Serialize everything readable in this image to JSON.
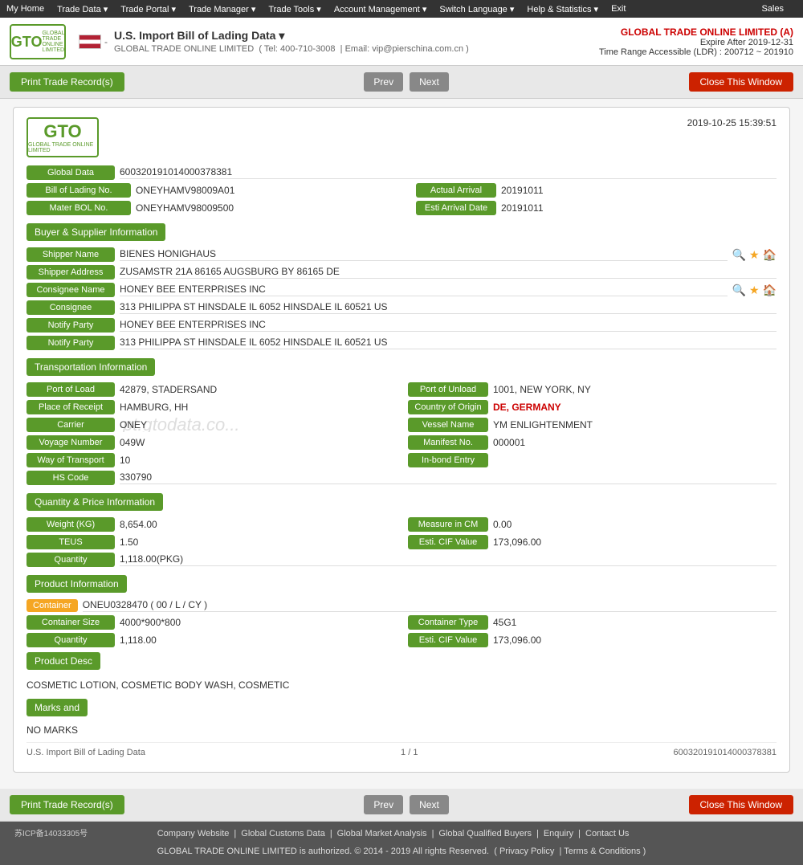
{
  "topnav": {
    "items": [
      "My Home",
      "Trade Data",
      "Trade Portal",
      "Trade Manager",
      "Trade Tools",
      "Account Management",
      "Switch Language",
      "Help & Statistics",
      "Exit"
    ],
    "sales": "Sales"
  },
  "header": {
    "title": "U.S. Import Bill of Lading Data  ▾",
    "company": "GLOBAL TRADE ONLINE LIMITED",
    "phone": "Tel: 400-710-3008",
    "email": "Email: vip@pierschina.com.cn",
    "account": "GLOBAL TRADE ONLINE LIMITED (A)",
    "expire": "Expire After 2019-12-31",
    "time_range": "Time Range Accessible (LDR) : 200712 ~ 201910"
  },
  "toolbar": {
    "print_label": "Print Trade Record(s)",
    "prev_label": "Prev",
    "next_label": "Next",
    "close_label": "Close This Window"
  },
  "document": {
    "timestamp": "2019-10-25 15:39:51",
    "global_data_label": "Global Data",
    "global_data_value": "600320191014000378381",
    "bol_label": "Bill of Lading No.",
    "bol_value": "ONEYHAMV98009A01",
    "actual_arrival_label": "Actual Arrival",
    "actual_arrival_value": "20191011",
    "mater_bol_label": "Mater BOL No.",
    "mater_bol_value": "ONEYHAMV98009500",
    "esti_arrival_label": "Esti Arrival Date",
    "esti_arrival_value": "20191011"
  },
  "buyer_supplier": {
    "section_title": "Buyer & Supplier Information",
    "shipper_name_label": "Shipper Name",
    "shipper_name_value": "BIENES HONIGHAUS",
    "shipper_address_label": "Shipper Address",
    "shipper_address_value": "ZUSAMSTR 21A 86165 AUGSBURG BY 86165 DE",
    "consignee_name_label": "Consignee Name",
    "consignee_name_value": "HONEY BEE ENTERPRISES INC",
    "consignee_label": "Consignee",
    "consignee_value": "313 PHILIPPA ST HINSDALE IL 6052 HINSDALE IL 60521 US",
    "notify_party_label": "Notify Party",
    "notify_party_value": "HONEY BEE ENTERPRISES INC",
    "notify_party2_label": "Notify Party",
    "notify_party2_value": "313 PHILIPPA ST HINSDALE IL 6052 HINSDALE IL 60521 US"
  },
  "transportation": {
    "section_title": "Transportation Information",
    "port_load_label": "Port of Load",
    "port_load_value": "42879, STADERSAND",
    "port_unload_label": "Port of Unload",
    "port_unload_value": "1001, NEW YORK, NY",
    "place_receipt_label": "Place of Receipt",
    "place_receipt_value": "HAMBURG, HH",
    "country_origin_label": "Country of Origin",
    "country_origin_value": "DE, GERMANY",
    "carrier_label": "Carrier",
    "carrier_value": "ONEY",
    "vessel_name_label": "Vessel Name",
    "vessel_name_value": "YM ENLIGHTENMENT",
    "voyage_label": "Voyage Number",
    "voyage_value": "049W",
    "manifest_label": "Manifest No.",
    "manifest_value": "000001",
    "way_transport_label": "Way of Transport",
    "way_transport_value": "10",
    "inbond_label": "In-bond Entry",
    "inbond_value": "",
    "hs_code_label": "HS Code",
    "hs_code_value": "330790"
  },
  "quantity_price": {
    "section_title": "Quantity & Price Information",
    "weight_label": "Weight (KG)",
    "weight_value": "8,654.00",
    "measure_label": "Measure in CM",
    "measure_value": "0.00",
    "teus_label": "TEUS",
    "teus_value": "1.50",
    "cif_label": "Esti. CIF Value",
    "cif_value": "173,096.00",
    "quantity_label": "Quantity",
    "quantity_value": "1,118.00(PKG)"
  },
  "product_info": {
    "section_title": "Product Information",
    "container_label": "Container",
    "container_value": "ONEU0328470 ( 00 / L / CY )",
    "container_size_label": "Container Size",
    "container_size_value": "4000*900*800",
    "container_type_label": "Container Type",
    "container_type_value": "45G1",
    "quantity_label": "Quantity",
    "quantity_value": "1,118.00",
    "cif_label": "Esti. CIF Value",
    "cif_value": "173,096.00",
    "product_desc_label": "Product Desc",
    "product_desc_value": "COSMETIC LOTION, COSMETIC BODY WASH, COSMETIC",
    "marks_label": "Marks and",
    "marks_value": "NO MARKS"
  },
  "page_footer": {
    "source": "U.S. Import Bill of Lading Data",
    "page_info": "1 / 1",
    "record_id": "600320191014000378381"
  },
  "bottom_nav": {
    "icp": "苏ICP备14033305号",
    "links": [
      "Company Website",
      "Global Customs Data",
      "Global Market Analysis",
      "Global Qualified Buyers",
      "Enquiry",
      "Contact Us"
    ],
    "copyright": "GLOBAL TRADE ONLINE LIMITED is authorized. © 2014 - 2019 All rights Reserved.",
    "privacy": "Privacy Policy",
    "terms": "Terms & Conditions"
  },
  "watermark": "pt.gtodata.co..."
}
